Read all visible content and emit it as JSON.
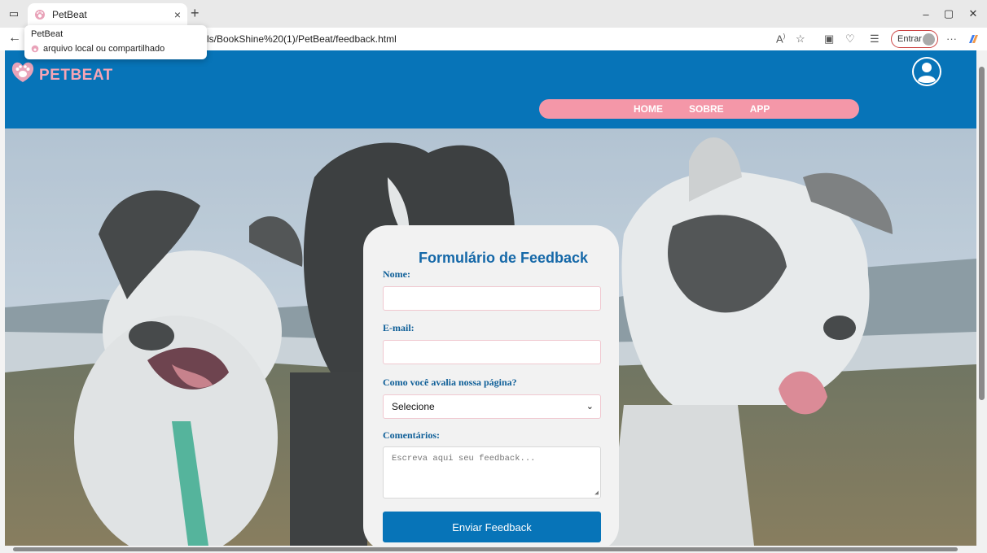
{
  "browser": {
    "tab_title": "PetBeat",
    "tab_close": "×",
    "new_tab": "+",
    "url": "ls/BookShine%20(1)/PetBeat/feedback.html",
    "tooltip_title": "PetBeat",
    "tooltip_sub": "arquivo local ou compartilhado",
    "signin_label": "Entrar",
    "more": "···",
    "minimize": "–",
    "restore": "▢",
    "close": "✕"
  },
  "site": {
    "logo": "PETBEAT",
    "nav": [
      "HOME",
      "SOBRE",
      "APP"
    ]
  },
  "form": {
    "title": "Formulário de Feedback",
    "name_label": "Nome:",
    "email_label": "E-mail:",
    "rating_label": "Como você avalia nossa página?",
    "rating_value": "Selecione",
    "comments_label": "Comentários:",
    "comments_placeholder": "Escreva aqui seu feedback...",
    "submit_label": "Enviar Feedback"
  },
  "colors": {
    "header": "#0774b8",
    "nav_pill": "#f497a8",
    "accent_text": "#1568a8",
    "button": "#0774b8"
  }
}
